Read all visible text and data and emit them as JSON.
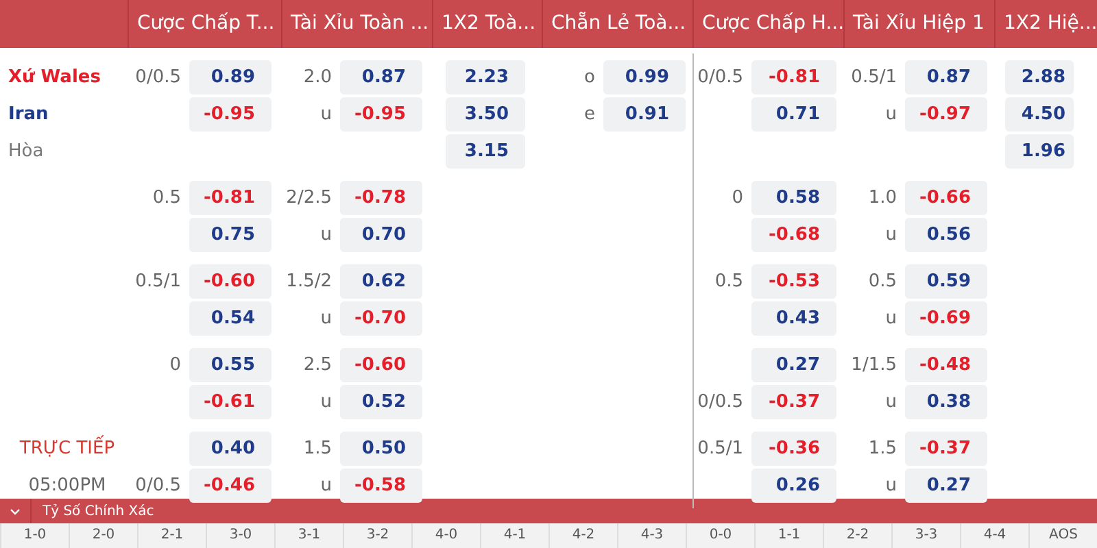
{
  "headers": [
    "Cược Chấp T...",
    "Tài Xỉu Toàn ...",
    "1X2 Toà...",
    "Chẵn Lẻ Toà...",
    "Cược Chấp H...",
    "Tài Xỉu Hiệp 1",
    "1X2 Hiệ..."
  ],
  "groups": [
    {
      "lines": [
        {
          "left": {
            "text": "Xứ Wales",
            "kind": "home"
          },
          "hdp": "0/0.5",
          "hdp_odd": {
            "value": "0.89",
            "negative": false
          },
          "ou": "2.0",
          "ou_odd": {
            "value": "0.87",
            "negative": false
          },
          "x12_odd": {
            "value": "2.23",
            "negative": false
          },
          "oe": "o",
          "oe_odd": {
            "value": "0.99",
            "negative": false
          },
          "hdp_h1": "0/0.5",
          "hdp_h1_odd": {
            "value": "-0.81",
            "negative": true
          },
          "ou_h1": "0.5/1",
          "ou_h1_odd": {
            "value": "0.87",
            "negative": false
          },
          "x12_h1_odd": {
            "value": "2.88",
            "negative": false
          }
        },
        {
          "left": {
            "text": "Iran",
            "kind": "away"
          },
          "hdp_odd": {
            "value": "-0.95",
            "negative": true
          },
          "ou": "u",
          "ou_odd": {
            "value": "-0.95",
            "negative": true
          },
          "x12_odd": {
            "value": "3.50",
            "negative": false
          },
          "oe": "e",
          "oe_odd": {
            "value": "0.91",
            "negative": false
          },
          "hdp_h1_odd": {
            "value": "0.71",
            "negative": false
          },
          "ou_h1": "u",
          "ou_h1_odd": {
            "value": "-0.97",
            "negative": true
          },
          "x12_h1_odd": {
            "value": "4.50",
            "negative": false
          }
        },
        {
          "left": {
            "text": "Hòa",
            "kind": "draw"
          },
          "x12_odd": {
            "value": "3.15",
            "negative": false
          },
          "x12_h1_odd": {
            "value": "1.96",
            "negative": false
          }
        }
      ]
    },
    {
      "lines": [
        {
          "hdp": "0.5",
          "hdp_odd": {
            "value": "-0.81",
            "negative": true
          },
          "ou": "2/2.5",
          "ou_odd": {
            "value": "-0.78",
            "negative": true
          },
          "hdp_h1": "0",
          "hdp_h1_odd": {
            "value": "0.58",
            "negative": false
          },
          "ou_h1": "1.0",
          "ou_h1_odd": {
            "value": "-0.66",
            "negative": true
          }
        },
        {
          "hdp_odd": {
            "value": "0.75",
            "negative": false
          },
          "ou": "u",
          "ou_odd": {
            "value": "0.70",
            "negative": false
          },
          "hdp_h1_odd": {
            "value": "-0.68",
            "negative": true
          },
          "ou_h1": "u",
          "ou_h1_odd": {
            "value": "0.56",
            "negative": false
          }
        }
      ]
    },
    {
      "lines": [
        {
          "hdp": "0.5/1",
          "hdp_odd": {
            "value": "-0.60",
            "negative": true
          },
          "ou": "1.5/2",
          "ou_odd": {
            "value": "0.62",
            "negative": false
          },
          "hdp_h1": "0.5",
          "hdp_h1_odd": {
            "value": "-0.53",
            "negative": true
          },
          "ou_h1": "0.5",
          "ou_h1_odd": {
            "value": "0.59",
            "negative": false
          }
        },
        {
          "hdp_odd": {
            "value": "0.54",
            "negative": false
          },
          "ou": "u",
          "ou_odd": {
            "value": "-0.70",
            "negative": true
          },
          "hdp_h1_odd": {
            "value": "0.43",
            "negative": false
          },
          "ou_h1": "u",
          "ou_h1_odd": {
            "value": "-0.69",
            "negative": true
          }
        }
      ]
    },
    {
      "lines": [
        {
          "hdp": "0",
          "hdp_odd": {
            "value": "0.55",
            "negative": false
          },
          "ou": "2.5",
          "ou_odd": {
            "value": "-0.60",
            "negative": true
          },
          "hdp_h1_odd": {
            "value": "0.27",
            "negative": false
          },
          "ou_h1": "1/1.5",
          "ou_h1_odd": {
            "value": "-0.48",
            "negative": true
          }
        },
        {
          "hdp_odd": {
            "value": "-0.61",
            "negative": true
          },
          "ou": "u",
          "ou_odd": {
            "value": "0.52",
            "negative": false
          },
          "hdp_h1": "0/0.5",
          "hdp_h1_odd": {
            "value": "-0.37",
            "negative": true
          },
          "ou_h1": "u",
          "ou_h1_odd": {
            "value": "0.38",
            "negative": false
          }
        }
      ]
    },
    {
      "lines": [
        {
          "left": {
            "text": "TRỰC TIẾP",
            "kind": "live"
          },
          "hdp_odd": {
            "value": "0.40",
            "negative": false
          },
          "ou": "1.5",
          "ou_odd": {
            "value": "0.50",
            "negative": false
          },
          "hdp_h1": "0.5/1",
          "hdp_h1_odd": {
            "value": "-0.36",
            "negative": true
          },
          "ou_h1": "1.5",
          "ou_h1_odd": {
            "value": "-0.37",
            "negative": true
          }
        },
        {
          "left": {
            "text": "05:00PM",
            "kind": "time"
          },
          "hdp": "0/0.5",
          "hdp_odd": {
            "value": "-0.46",
            "negative": true
          },
          "ou": "u",
          "ou_odd": {
            "value": "-0.58",
            "negative": true
          },
          "hdp_h1_odd": {
            "value": "0.26",
            "negative": false
          },
          "ou_h1": "u",
          "ou_h1_odd": {
            "value": "0.27",
            "negative": false
          }
        }
      ]
    }
  ],
  "section": {
    "title": "Tỷ Số Chính Xác",
    "expanded": true
  },
  "scores": [
    "1-0",
    "2-0",
    "2-1",
    "3-0",
    "3-1",
    "3-2",
    "4-0",
    "4-1",
    "4-2",
    "4-3",
    "0-0",
    "1-1",
    "2-2",
    "3-3",
    "4-4",
    "AOS"
  ]
}
